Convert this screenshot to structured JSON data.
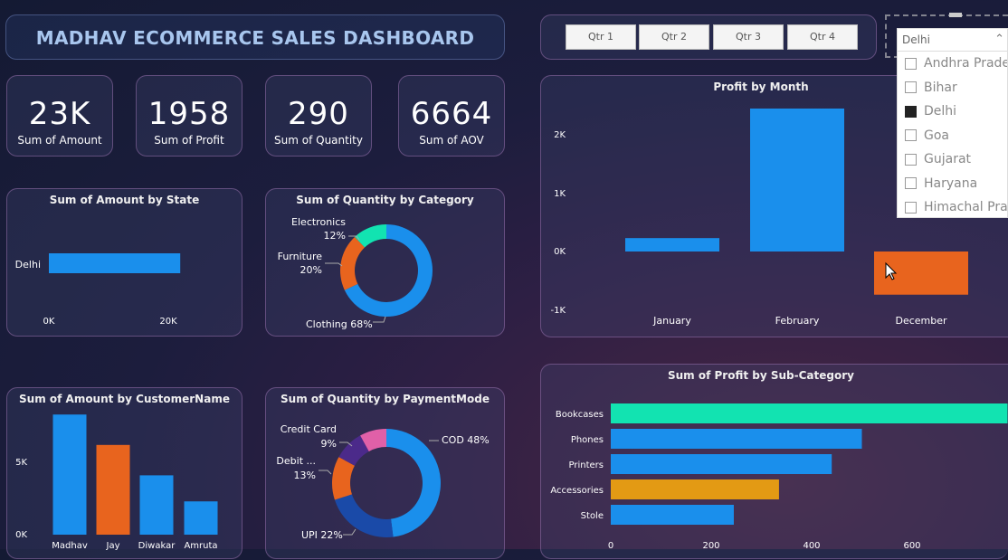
{
  "dashboard_title": "MADHAV ECOMMERCE SALES DASHBOARD",
  "kpis": [
    {
      "value": "23K",
      "label": "Sum of Amount"
    },
    {
      "value": "1958",
      "label": "Sum of Profit"
    },
    {
      "value": "290",
      "label": "Sum of Quantity"
    },
    {
      "value": "6664",
      "label": "Sum of AOV"
    }
  ],
  "quarters": [
    "Qtr 1",
    "Qtr 2",
    "Qtr 3",
    "Qtr 4"
  ],
  "state_slicer": {
    "selected": "Delhi",
    "options": [
      {
        "label": "Andhra Prade...",
        "checked": false
      },
      {
        "label": "Bihar",
        "checked": false
      },
      {
        "label": "Delhi",
        "checked": true
      },
      {
        "label": "Goa",
        "checked": false
      },
      {
        "label": "Gujarat",
        "checked": false
      },
      {
        "label": "Haryana",
        "checked": false
      },
      {
        "label": "Himachal Pra...",
        "checked": false
      }
    ]
  },
  "colors": {
    "blue": "#1a8fec",
    "orange": "#e8641e",
    "teal": "#12e3b1",
    "gold": "#e39a14",
    "purple": "#4b2a8a",
    "pink": "#e060a8",
    "darkblue": "#1a4aa8"
  },
  "chart_data": [
    {
      "id": "amount_by_state",
      "type": "bar",
      "orientation": "horizontal",
      "title": "Sum of Amount by State",
      "categories": [
        "Delhi"
      ],
      "values": [
        22000
      ],
      "xlim": [
        0,
        25000
      ],
      "ticks": [
        "0K",
        "20K"
      ]
    },
    {
      "id": "quantity_by_category",
      "type": "pie",
      "donut": true,
      "title": "Sum of Quantity by Category",
      "labels": [
        "Clothing",
        "Furniture",
        "Electronics"
      ],
      "values": [
        68,
        20,
        12
      ],
      "label_texts": [
        "Clothing 68%",
        "Furniture\n20%",
        "Electronics\n12%"
      ]
    },
    {
      "id": "profit_by_month",
      "type": "bar",
      "title": "Profit by Month",
      "categories": [
        "January",
        "February",
        "December"
      ],
      "values": [
        230,
        2450,
        -740
      ],
      "ylim": [
        -1000,
        2500
      ],
      "ticks": [
        "-1K",
        "0K",
        "1K",
        "2K"
      ]
    },
    {
      "id": "amount_by_customer",
      "type": "bar",
      "title": "Sum of Amount by CustomerName",
      "categories": [
        "Madhav",
        "Jay",
        "Diwakar",
        "Amruta"
      ],
      "values": [
        8300,
        6200,
        4100,
        2300
      ],
      "ylim": [
        0,
        10000
      ],
      "ticks": [
        "0K",
        "5K"
      ]
    },
    {
      "id": "quantity_by_paymentmode",
      "type": "pie",
      "donut": true,
      "title": "Sum of Quantity by PaymentMode",
      "labels": [
        "COD",
        "UPI",
        "Debit ...",
        "Credit Card",
        "Other"
      ],
      "values": [
        48,
        22,
        13,
        9,
        8
      ],
      "label_texts": [
        "COD 48%",
        "UPI 22%",
        "Debit ...\n13%",
        "Credit Card\n9%"
      ]
    },
    {
      "id": "profit_by_subcategory",
      "type": "bar",
      "orientation": "horizontal",
      "title": "Sum of Profit by Sub-Category",
      "categories": [
        "Bookcases",
        "Phones",
        "Printers",
        "Accessories",
        "Stole"
      ],
      "values": [
        790,
        500,
        440,
        335,
        245
      ],
      "xlim": [
        0,
        800
      ],
      "ticks": [
        "0",
        "200",
        "400",
        "600",
        "8"
      ]
    }
  ]
}
